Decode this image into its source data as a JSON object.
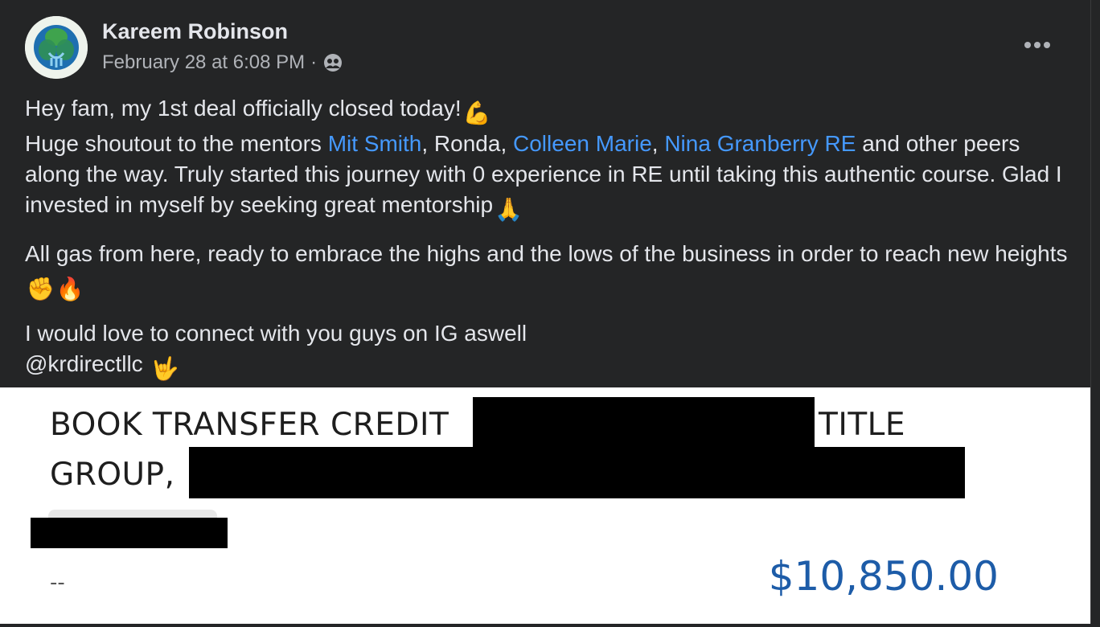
{
  "post": {
    "author": "Kareem Robinson",
    "timestamp": "February 28 at 6:08 PM",
    "separator": "·",
    "audience_icon": "friends-icon",
    "more_icon": "more-icon"
  },
  "content": {
    "p1_line1": "Hey fam, my 1st deal officially closed  today!",
    "p1_line1_emoji": "💪",
    "p1_line2_start": " Huge shoutout to the mentors ",
    "mention1": "Mit Smith",
    "p1_sep1": ", Ronda, ",
    "mention2": "Colleen Marie",
    "p1_sep2": ", ",
    "mention3": "Nina Granberry RE",
    "p1_line2_end": " and other peers along the way. Truly started this journey with 0 experience in RE until taking this authentic course. Glad I invested in myself by seeking great mentorship",
    "p1_end_emoji": "🙏",
    "p2_text": "All gas from here, ready to embrace the highs and the lows of the business in order to reach new heights ",
    "p2_emoji1": "✊",
    "p2_emoji2": "🔥",
    "p3_line1": "I would love to connect with you guys on IG aswell",
    "p3_line2": "@krdirectllc ",
    "p3_emoji": "🤟"
  },
  "attachment": {
    "line1_start": "BOOK TRANSFER CREDIT",
    "line1_end": "TITLE",
    "line2_start": "GROUP,",
    "dash": "--",
    "amount": "$10,850.00"
  },
  "colors": {
    "background": "#242526",
    "text": "#e4e6eb",
    "secondary_text": "#b0b3b8",
    "mention": "#4599ff",
    "amount": "#1d5ca8"
  }
}
